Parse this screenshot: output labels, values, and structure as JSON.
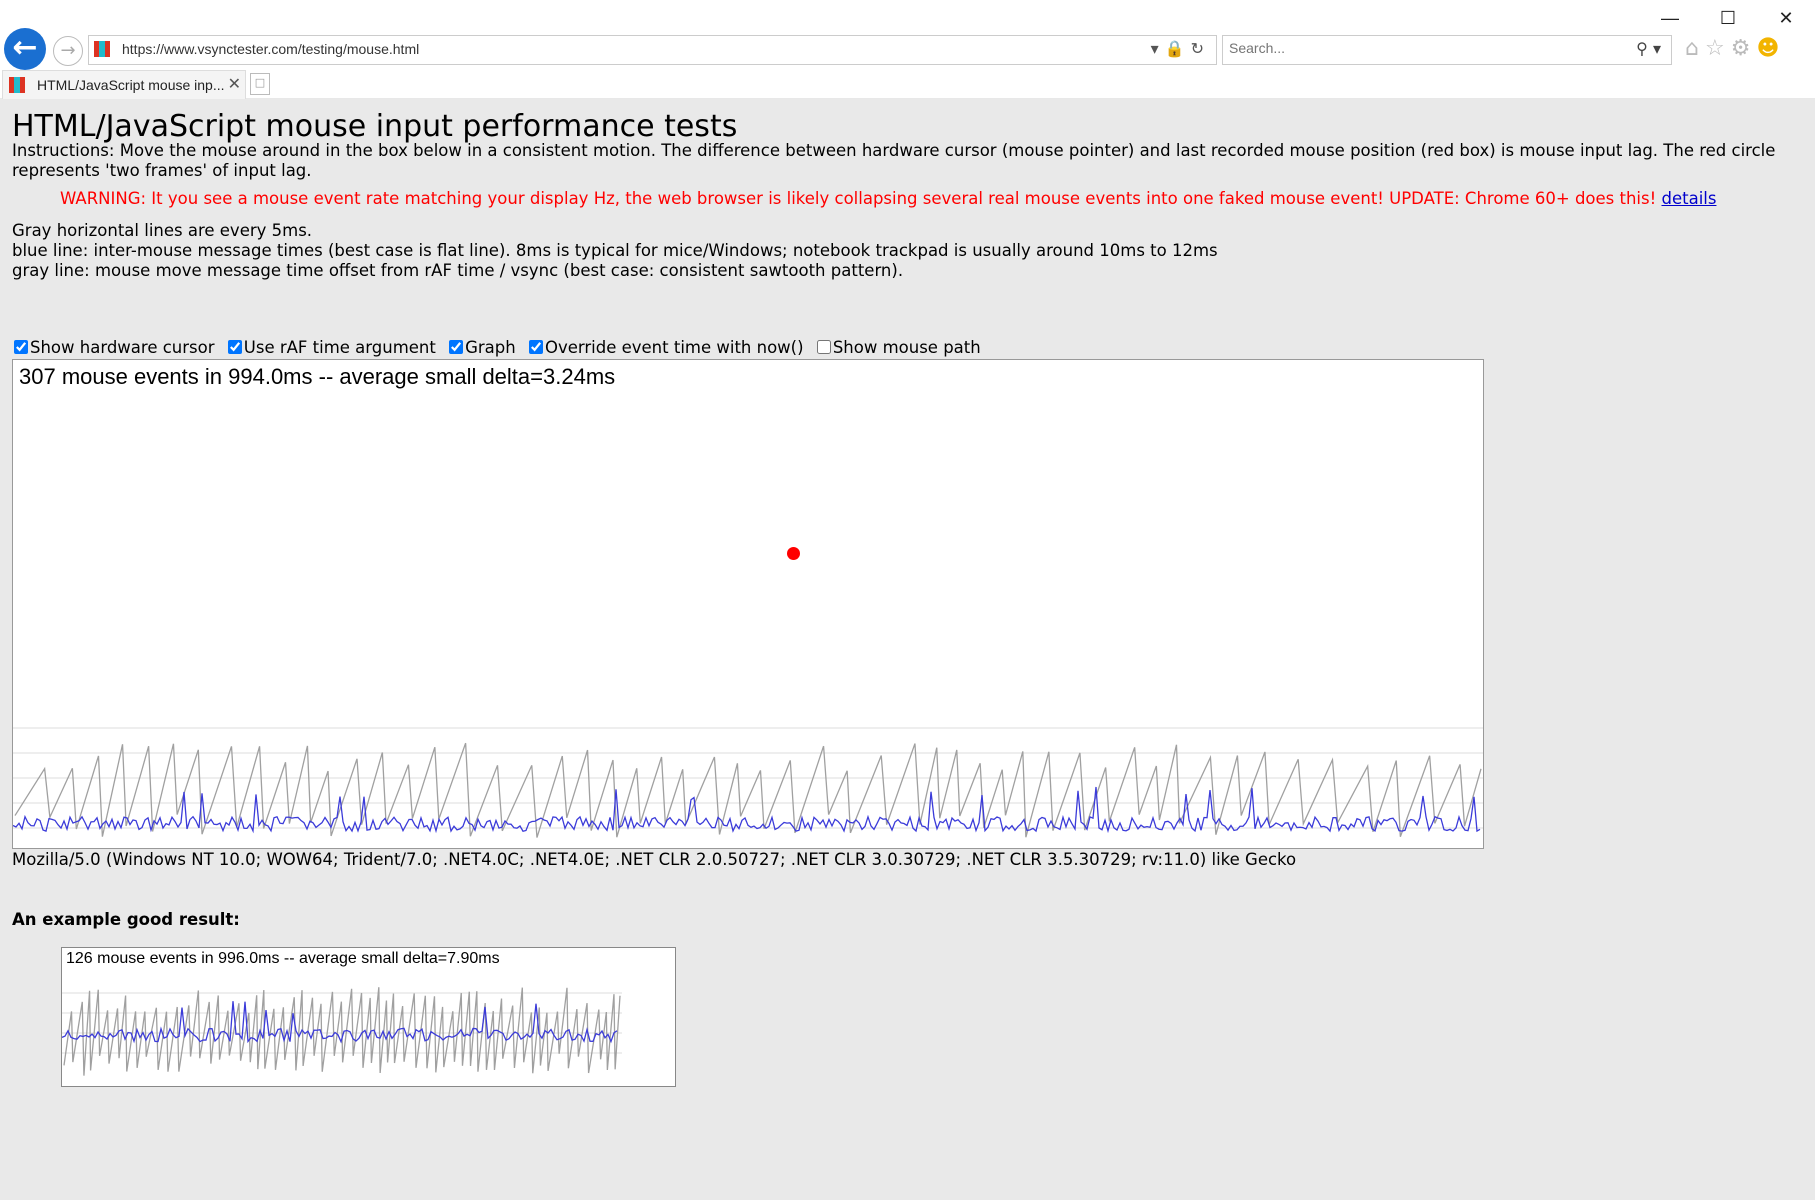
{
  "browser": {
    "url": "https://www.vsynctester.com/testing/mouse.html",
    "search_placeholder": "Search...",
    "tab_title": "HTML/JavaScript mouse inp...",
    "window_controls": [
      "minimize-icon",
      "maximize-icon",
      "close-icon"
    ],
    "toolbar_icons": [
      "home-icon",
      "star-icon",
      "gear-icon",
      "smiley-icon"
    ]
  },
  "page": {
    "title": "HTML/JavaScript mouse input performance tests",
    "instructions": "Instructions: Move the mouse around in the box below in a consistent motion. The difference between hardware cursor (mouse pointer) and last recorded mouse position (red box) is mouse input lag. The red circle represents 'two frames' of input lag.",
    "warning": "WARNING: It you see a mouse event rate matching your display Hz, the web browser is likely collapsing several real mouse events into one faked mouse event! UPDATE: Chrome 60+ does this!",
    "warning_link": "details",
    "legend_lines": [
      "Gray horizontal lines are every 5ms.",
      "blue line: inter-mouse message times (best case is flat line). 8ms is typical for mice/Windows; notebook trackpad is usually around 10ms to 12ms",
      "gray line: mouse move message time offset from rAF time / vsync (best case: consistent sawtooth pattern)."
    ],
    "options": [
      {
        "label": "Show hardware cursor",
        "checked": true
      },
      {
        "label": "Use rAF time argument",
        "checked": true
      },
      {
        "label": "Graph",
        "checked": true
      },
      {
        "label": "Override event time with now()",
        "checked": true
      },
      {
        "label": "Show mouse path",
        "checked": false
      }
    ],
    "test_stats": "307 mouse events in 994.0ms -- average small delta=3.24ms",
    "user_agent": "Mozilla/5.0 (Windows NT 10.0; WOW64; Trident/7.0; .NET4.0C; .NET4.0E; .NET CLR 2.0.50727; .NET CLR 3.0.30729; .NET CLR 3.5.30729; rv:11.0) like Gecko",
    "example_title": "An example good result:",
    "example_stats": "126 mouse events in 996.0ms -- average small delta=7.90ms"
  },
  "colors": {
    "warning": "#ff0000",
    "red_dot": "#ff0000",
    "blue_line": "#3b3bd9",
    "gray_line": "#a0a0a0",
    "grid_line": "#dcdcdc",
    "link": "#0000cc"
  }
}
